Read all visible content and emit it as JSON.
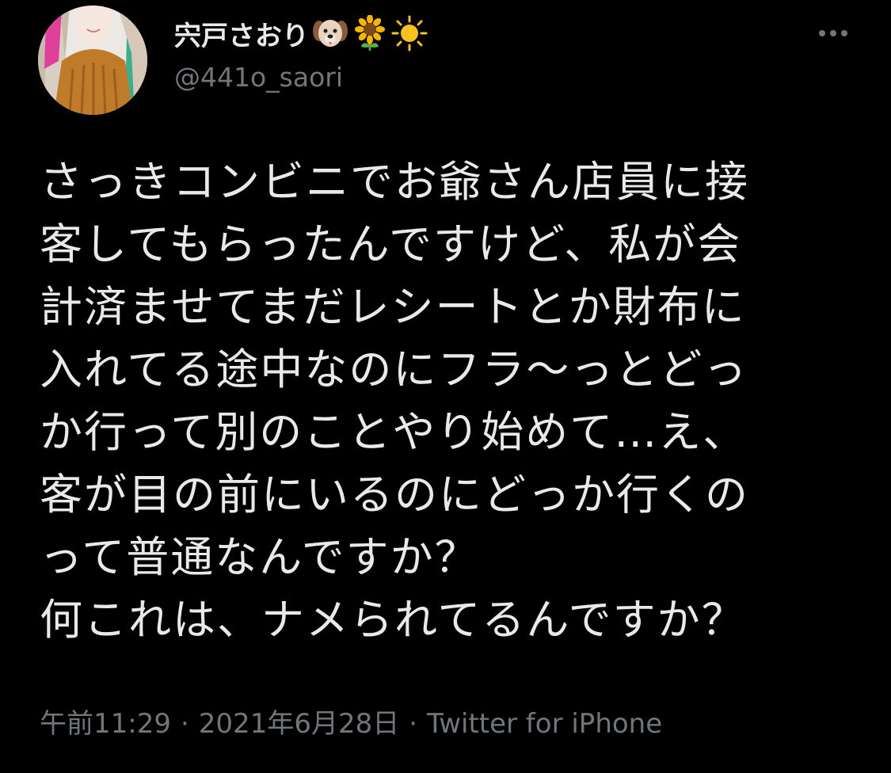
{
  "author": {
    "display_name": "宍戸さおり",
    "name_emojis": [
      "dog-face-emoji",
      "sunflower-emoji",
      "sun-emoji"
    ],
    "handle": "@441o_saori"
  },
  "tweet": {
    "lines": [
      "さっきコンビニでお爺さん店員に接",
      "客してもらったんですけど、私が会",
      "計済ませてまだレシートとか財布に",
      "入れてる途中なのにフラ〜っとどっ",
      "か行って別のことやり始めて…え、",
      "客が目の前にいるのにどっか行くの",
      "って普通なんですか？",
      "何これは、ナメられてるんですか？"
    ]
  },
  "meta": {
    "time": "午前11:29",
    "separator": "·",
    "date": "2021年6月28日",
    "source": "Twitter for iPhone"
  },
  "colors": {
    "background": "#000000",
    "text_primary": "#e7e9ea",
    "text_secondary": "#71767b"
  },
  "icons": {
    "more": "more-options-icon"
  }
}
